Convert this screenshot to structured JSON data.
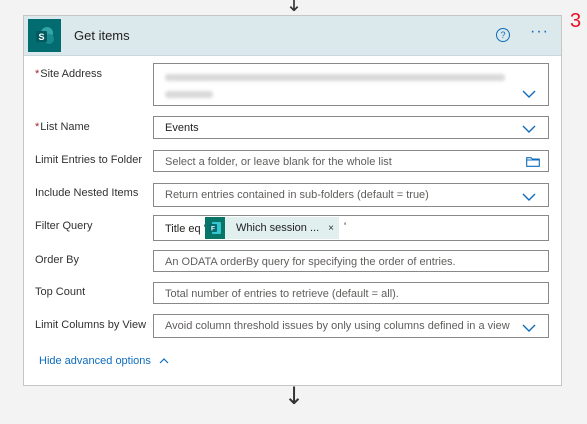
{
  "header": {
    "title": "Get items",
    "step_number": "3",
    "help_glyph": "?",
    "more_glyph": "···"
  },
  "fields": {
    "site_address": {
      "label": "Site Address",
      "required": true
    },
    "list_name": {
      "label": "List Name",
      "required": true,
      "value": "Events"
    },
    "limit_folder": {
      "label": "Limit Entries to Folder",
      "placeholder": "Select a folder, or leave blank for the whole list"
    },
    "nested_items": {
      "label": "Include Nested Items",
      "placeholder": "Return entries contained in sub-folders (default = true)"
    },
    "filter_query": {
      "label": "Filter Query",
      "prefix": "Title eq '",
      "token_label": "Which session ...",
      "token_close": "×",
      "suffix": "'"
    },
    "order_by": {
      "label": "Order By",
      "placeholder": "An ODATA orderBy query for specifying the order of entries."
    },
    "top_count": {
      "label": "Top Count",
      "placeholder": "Total number of entries to retrieve (default = all)."
    },
    "limit_columns": {
      "label": "Limit Columns by View",
      "placeholder": "Avoid column threshold issues by only using columns defined in a view"
    }
  },
  "footer": {
    "advanced_link": "Hide advanced options"
  },
  "icons": {
    "sharepoint": "sharepoint-icon",
    "forms": "forms-icon",
    "chevron": "chevron-down-icon",
    "folder": "folder-icon",
    "arrow": "arrow-down-icon"
  },
  "colors": {
    "header_bg": "#dbe9ec",
    "sharepoint_brand": "#036c70",
    "forms_brand": "#077568",
    "link_blue": "#0f6cbd",
    "required_red": "#a4262c",
    "step_red": "#e81123"
  }
}
